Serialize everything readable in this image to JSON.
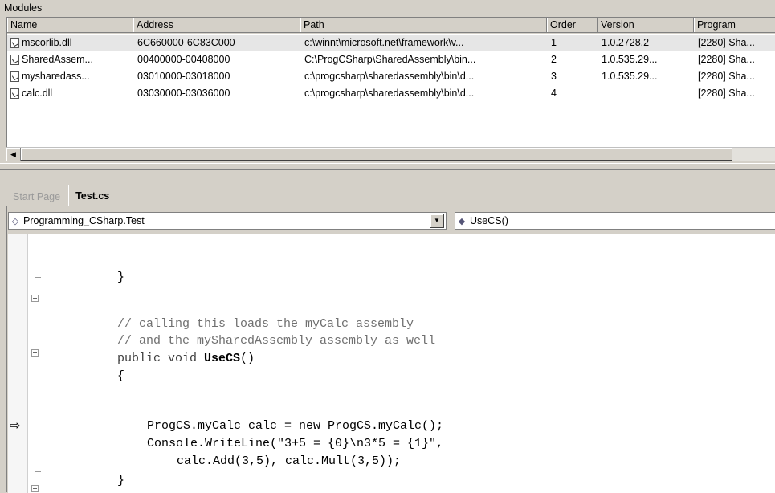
{
  "modules": {
    "title": "Modules",
    "columns": [
      "Name",
      "Address",
      "Path",
      "Order",
      "Version",
      "Program"
    ],
    "rows": [
      {
        "name": "mscorlib.dll",
        "address": "6C660000-6C83C000",
        "path": "c:\\winnt\\microsoft.net\\framework\\v...",
        "order": "1",
        "version": "1.0.2728.2",
        "program": "[2280] Sha..."
      },
      {
        "name": "SharedAssem...",
        "address": "00400000-00408000",
        "path": "C:\\ProgCSharp\\SharedAssembly\\bin...",
        "order": "2",
        "version": "1.0.535.29...",
        "program": "[2280] Sha..."
      },
      {
        "name": "mysharedass...",
        "address": "03010000-03018000",
        "path": "c:\\progcsharp\\sharedassembly\\bin\\d...",
        "order": "3",
        "version": "1.0.535.29...",
        "program": "[2280] Sha..."
      },
      {
        "name": "calc.dll",
        "address": "03030000-03036000",
        "path": "c:\\progcsharp\\sharedassembly\\bin\\d...",
        "order": "4",
        "version": "",
        "program": "[2280] Sha..."
      }
    ],
    "icons": {
      "row_icon": "dll-module-icon",
      "scroll_left": "scroll-left-arrow-icon"
    }
  },
  "editor": {
    "tabs": [
      "Start Page",
      "Test.cs"
    ],
    "active_tab": "Test.cs",
    "class_combo": "Programming_CSharp.Test",
    "member_combo": "UseCS()",
    "code": {
      "l1": "}",
      "l2": "// calling this loads the myCalc assembly",
      "l3": "// and the mySharedAssembly assembly as well",
      "l4_kw": "public void ",
      "l4_name": "UseCS",
      "l4_rest": "()",
      "l5": "{",
      "l6": "ProgCS.myCalc calc = new ProgCS.myCalc();",
      "l7": "Console.WriteLine(\"3+5 = {0}\\n3*5 = {1}\",",
      "l8": "calc.Add(3,5), calc.Mult(3,5));",
      "l9": "}"
    },
    "icons": {
      "current_line": "execution-arrow-icon"
    }
  }
}
